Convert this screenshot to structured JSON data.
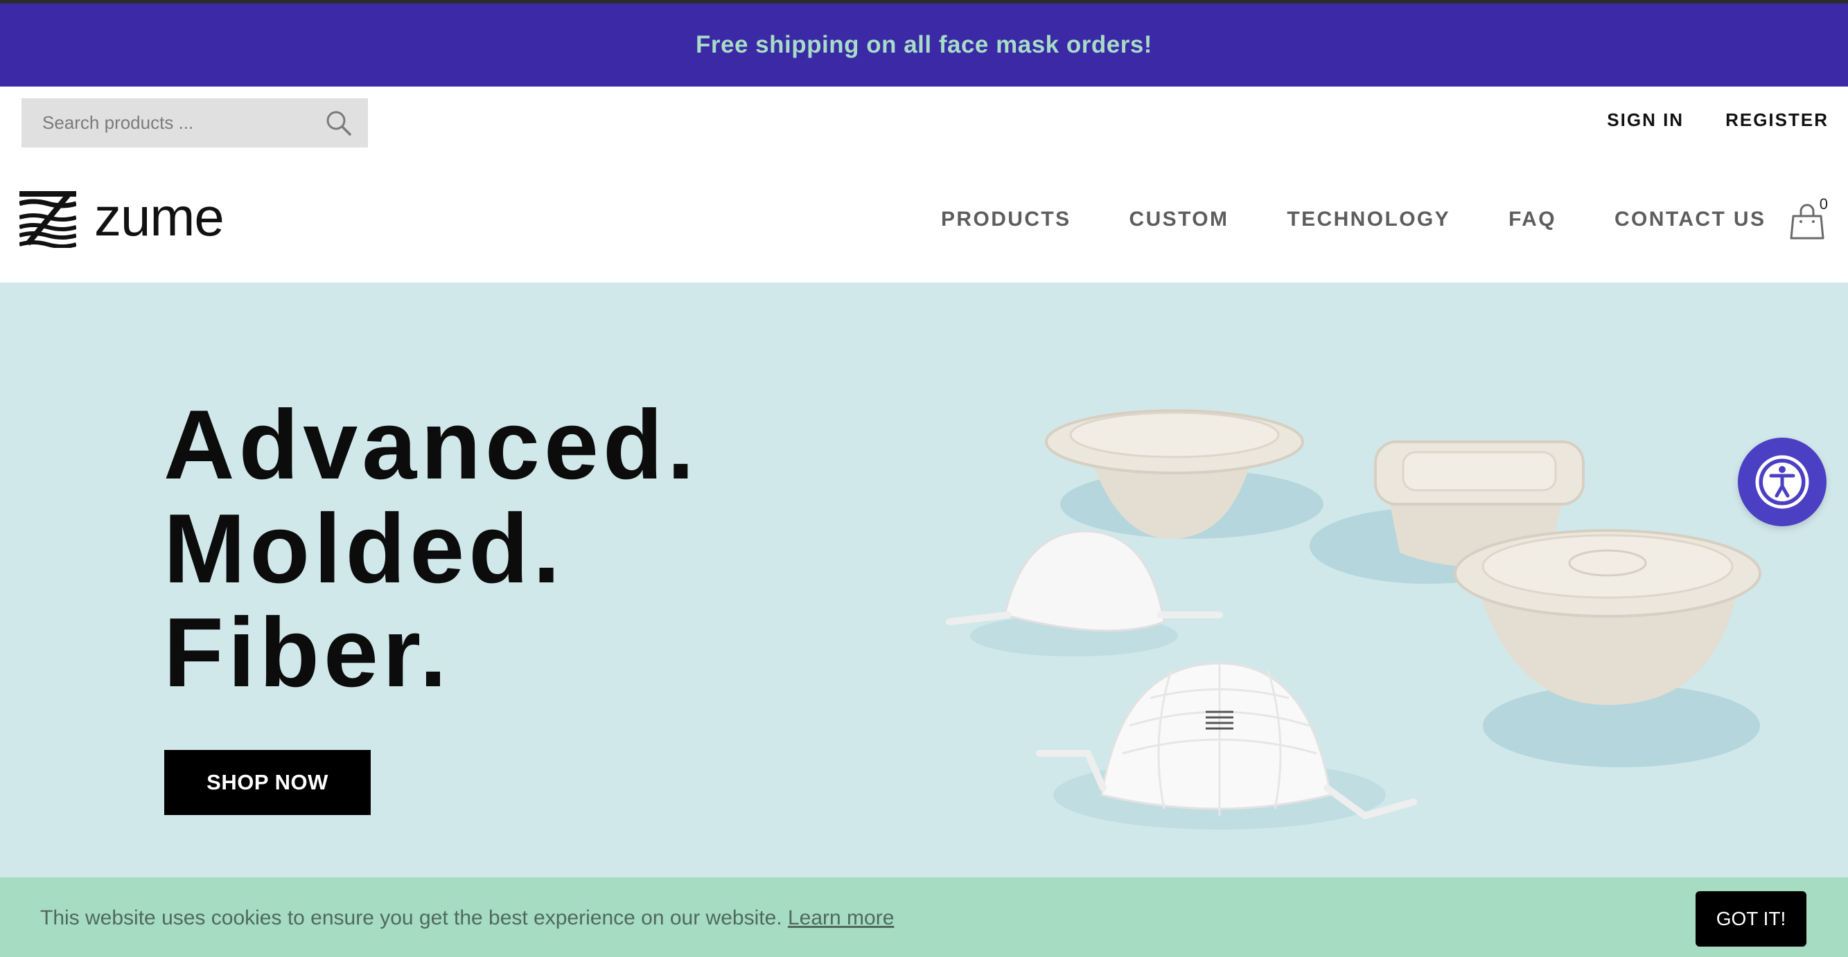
{
  "promo": {
    "text": "Free shipping on all face mask orders!"
  },
  "search": {
    "placeholder": "Search products ..."
  },
  "account": {
    "sign_in": "SIGN IN",
    "register": "REGISTER"
  },
  "brand": {
    "name": "zume"
  },
  "nav": {
    "items": [
      {
        "label": "PRODUCTS"
      },
      {
        "label": "CUSTOM"
      },
      {
        "label": "TECHNOLOGY"
      },
      {
        "label": "FAQ"
      },
      {
        "label": "CONTACT US"
      }
    ]
  },
  "cart": {
    "count": "0",
    "icon": "shopping-bag-icon"
  },
  "hero": {
    "lines": [
      "Advanced.",
      "Molded.",
      "Fiber."
    ],
    "cta": "SHOP NOW"
  },
  "cookie": {
    "message": "This website uses cookies to ensure you get the best experience on our website.",
    "learn_more": "Learn more",
    "accept": "GOT IT!"
  },
  "colors": {
    "promo_bg": "#3b29a6",
    "promo_text": "#a7dcc6",
    "hero_bg": "#d1e8ea",
    "cookie_bg": "#a6dcc1",
    "accessibility_button": "#4b3fc4"
  }
}
